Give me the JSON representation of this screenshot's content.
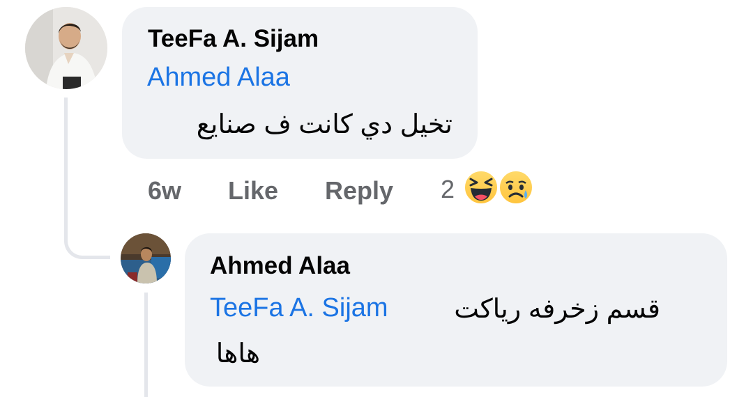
{
  "comment": {
    "author": "TeeFa A. Sijam",
    "mention": "Ahmed Alaa",
    "text": "تخيل دي كانت ف صنايع",
    "time": "6w",
    "like_label": "Like",
    "reply_label": "Reply",
    "reaction_count": "2",
    "reactions": [
      "haha-icon",
      "sad-icon"
    ]
  },
  "reply": {
    "author": "Ahmed Alaa",
    "mention": "TeeFa A. Sijam",
    "text_line1": "قسم زخرفه رياكت",
    "text_line2": "هاها"
  },
  "colors": {
    "bubble": "#f0f2f5",
    "mention": "#1b74e4",
    "meta": "#65676b",
    "thread": "#e4e6eb"
  }
}
